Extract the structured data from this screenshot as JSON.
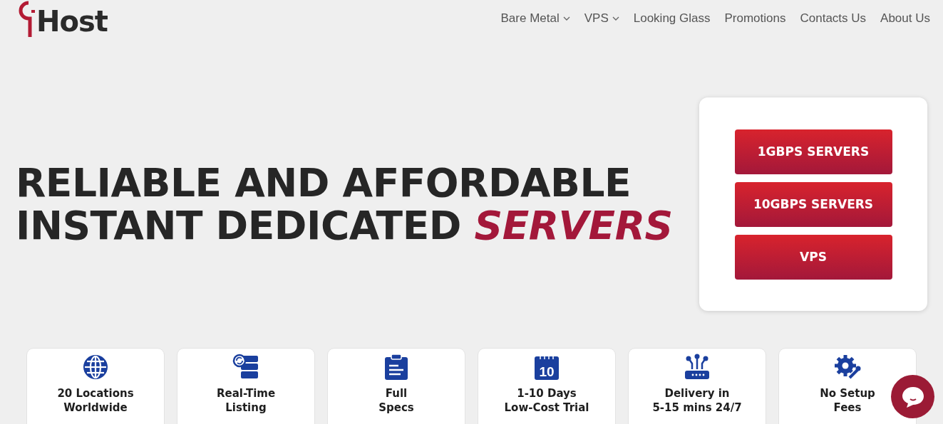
{
  "logo": {
    "text": "Host"
  },
  "nav": [
    {
      "label": "Bare Metal",
      "dropdown": true
    },
    {
      "label": "VPS",
      "dropdown": true
    },
    {
      "label": "Looking Glass",
      "dropdown": false
    },
    {
      "label": "Promotions",
      "dropdown": false
    },
    {
      "label": "Contacts Us",
      "dropdown": false
    },
    {
      "label": "About Us",
      "dropdown": false
    }
  ],
  "hero": {
    "line_1": "RELIABLE AND AFFORDABLE",
    "line_2": "INSTANT DEDICATED",
    "highlight": "SERVERS"
  },
  "quick_links": [
    "1GBPS SERVERS",
    "10GBPS SERVERS",
    "VPS"
  ],
  "features": [
    {
      "kind": "globe",
      "title": "20 Locations",
      "subtitle": "Worldwide"
    },
    {
      "kind": "server",
      "title": "Real-Time",
      "subtitle": "Listing"
    },
    {
      "kind": "clipboard",
      "title": "Full",
      "subtitle": "Specs"
    },
    {
      "kind": "calendar",
      "icon_label": "10",
      "title": "1-10 Days",
      "subtitle": "Low-Cost Trial"
    },
    {
      "kind": "router",
      "title": "Delivery in",
      "subtitle": "5-15 mins 24/7"
    },
    {
      "kind": "gear",
      "title": "No Setup",
      "subtitle": "Fees"
    }
  ]
}
